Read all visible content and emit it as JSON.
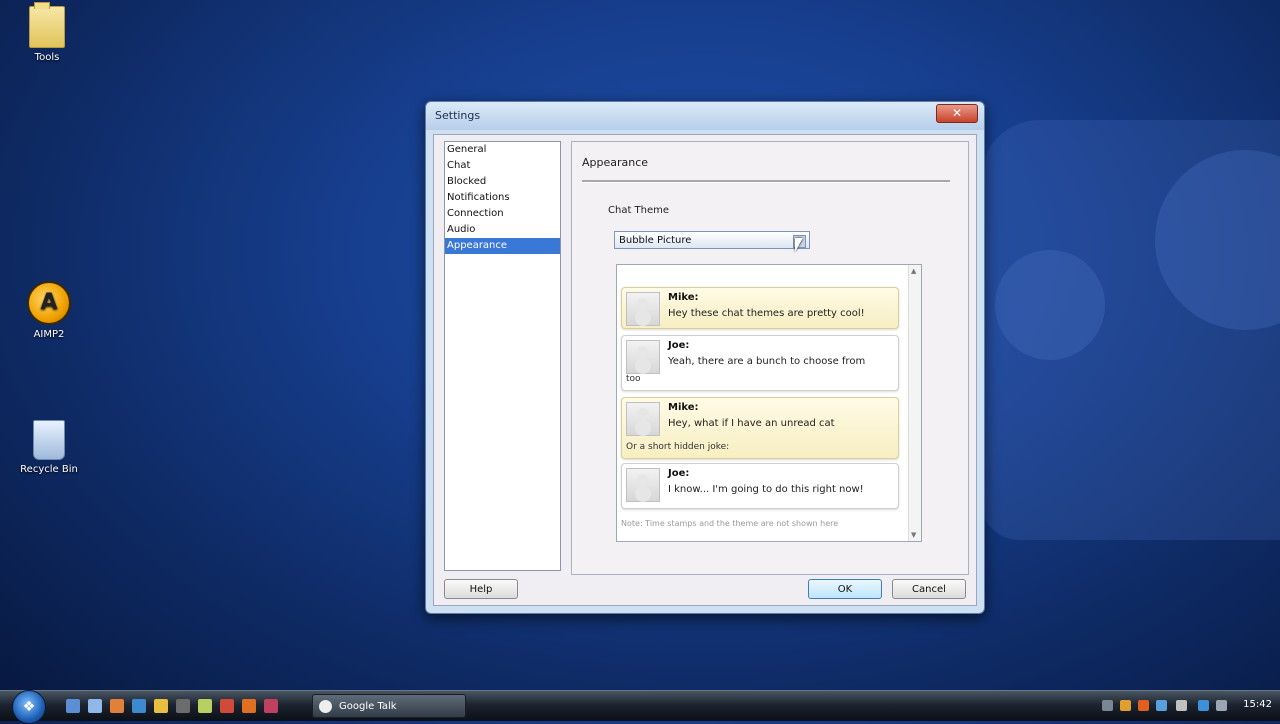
{
  "desktop": {
    "icons": [
      {
        "label": "Tools",
        "icon": "folder-icon"
      },
      {
        "label": "AIMP2",
        "icon": "aimp-icon"
      },
      {
        "label": "Recycle Bin",
        "icon": "recycle-bin-icon"
      }
    ]
  },
  "dialog": {
    "title": "Settings",
    "close_label": "✕",
    "categories": [
      "General",
      "Chat",
      "Blocked",
      "Notifications",
      "Connection",
      "Audio",
      "Appearance"
    ],
    "selected_category_index": 6,
    "panel_header": "Appearance",
    "chat_theme_label": "Chat Theme",
    "chat_theme_value": "Bubble Picture",
    "preview": {
      "messages": [
        {
          "name": "Mike:",
          "text": "Hey these chat themes are pretty cool!",
          "extra": ""
        },
        {
          "name": "Joe:",
          "text": "Yeah, there are a bunch to choose from",
          "extra": "too"
        },
        {
          "name": "Mike:",
          "text": "Hey, what if I have an unread cat",
          "extra": "Or a short hidden joke:"
        },
        {
          "name": "Joe:",
          "text": "I know... I'm going to do this right now!",
          "extra": ""
        }
      ],
      "footer": "Note: Time stamps and the theme are not shown here"
    },
    "buttons": {
      "help": "Help",
      "ok": "OK",
      "cancel": "Cancel"
    }
  },
  "taskbar": {
    "active_window": "Google Talk",
    "clock": "15:42",
    "start_icon": "windows-start-icon"
  }
}
